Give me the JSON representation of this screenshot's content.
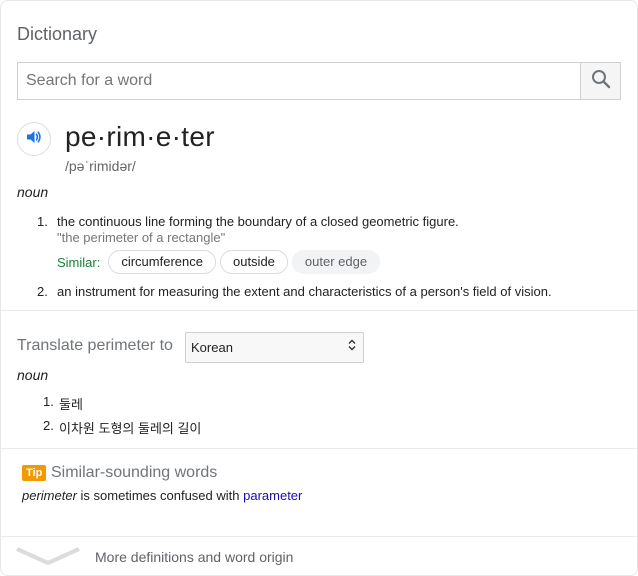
{
  "header": {
    "title": "Dictionary"
  },
  "search": {
    "placeholder": "Search for a word",
    "value": ""
  },
  "entry": {
    "word": "pe·rim·e·ter",
    "phonetic": "/pəˈrimidər/",
    "part_of_speech": "noun",
    "definitions": [
      {
        "number": "1.",
        "text": "the continuous line forming the boundary of a closed geometric figure.",
        "example": "\"the perimeter of a rectangle\"",
        "similar_label": "Similar:",
        "similar": [
          "circumference",
          "outside",
          "outer edge"
        ]
      },
      {
        "number": "2.",
        "text": "an instrument for measuring the extent and characteristics of a person's field of vision."
      }
    ]
  },
  "translate": {
    "label": "Translate perimeter to",
    "language": "Korean",
    "part_of_speech": "noun",
    "items": [
      {
        "number": "1.",
        "text": "둘레"
      },
      {
        "number": "2.",
        "text": "이차원 도형의 둘레의 길이"
      }
    ]
  },
  "tip": {
    "badge": "Tip",
    "title": "Similar-sounding words",
    "word": "perimeter",
    "middle": " is sometimes confused with ",
    "link": "parameter"
  },
  "footer": {
    "more_label": "More definitions and word origin"
  },
  "colors": {
    "accent_blue": "#1a73e8",
    "similar_green": "#188038",
    "tip_orange": "#f29900",
    "link": "#1a0dab"
  }
}
